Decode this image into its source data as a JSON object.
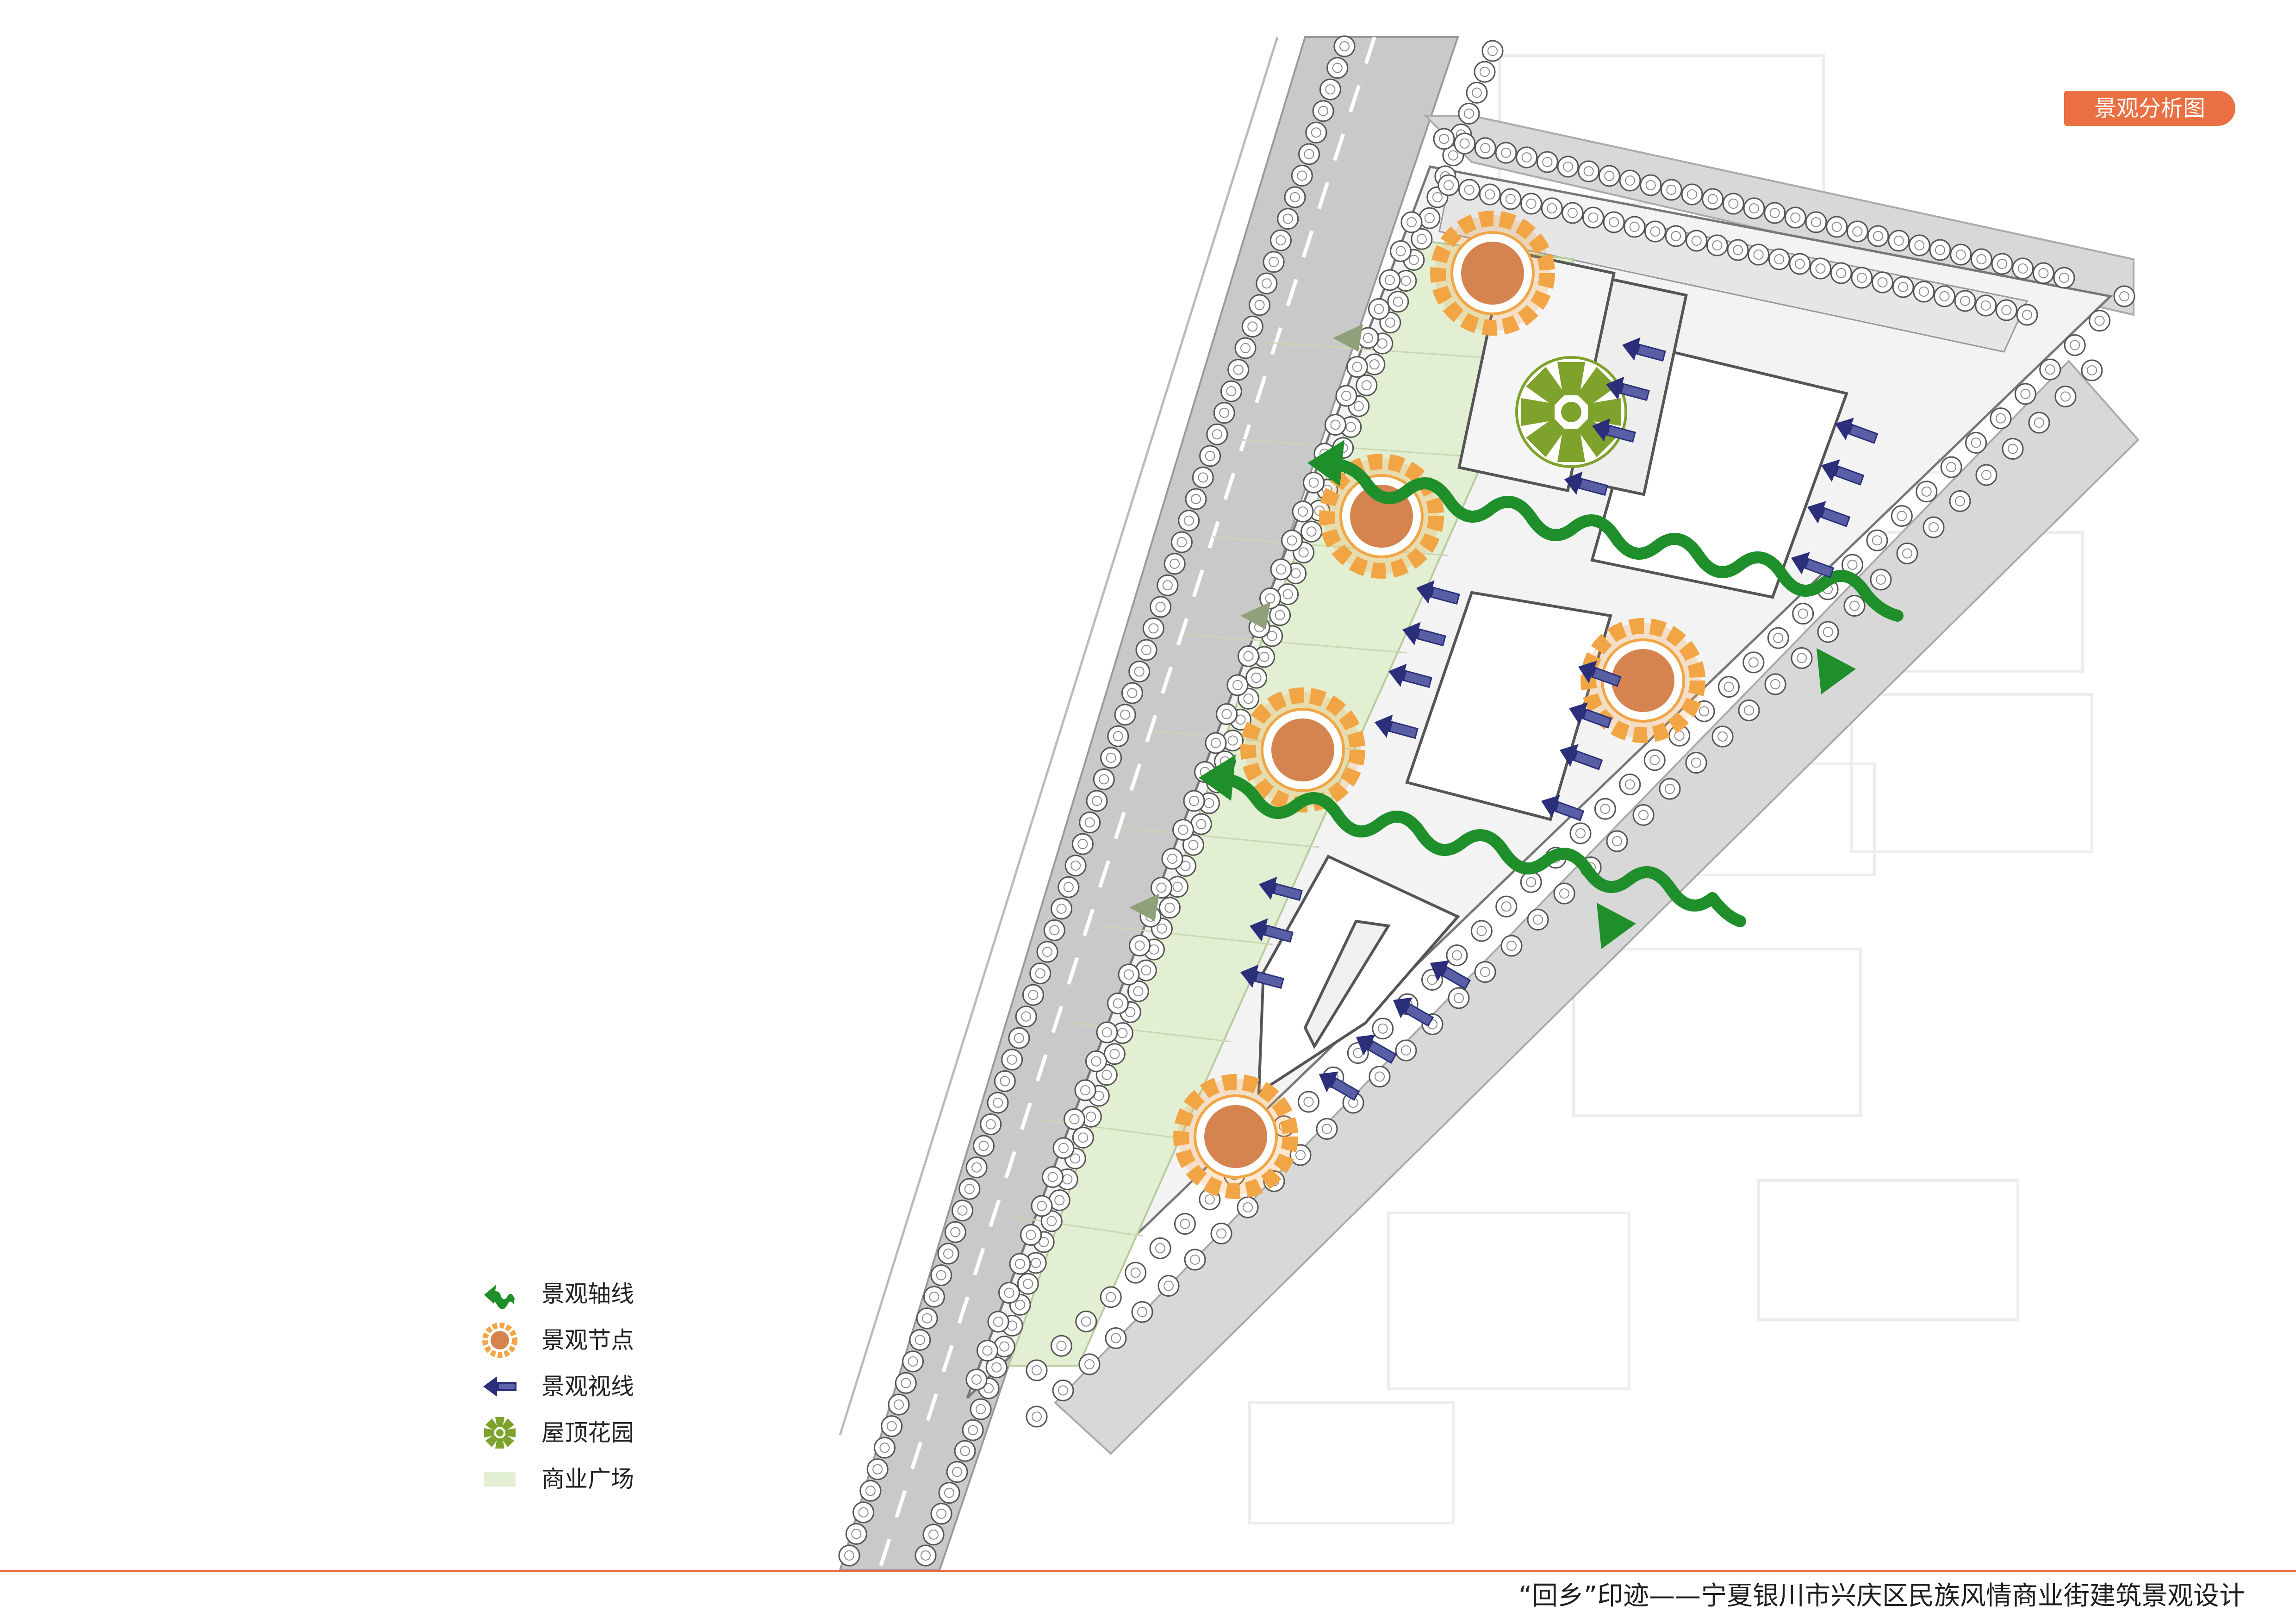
{
  "title": "景观分析图",
  "legend": [
    {
      "icon": "axis-arrow-icon",
      "label": "景观轴线"
    },
    {
      "icon": "node-ring-icon",
      "label": "景观节点"
    },
    {
      "icon": "view-arrow-icon",
      "label": "景观视线"
    },
    {
      "icon": "roof-garden-icon",
      "label": "屋顶花园"
    },
    {
      "icon": "plaza-swatch-icon",
      "label": "商业广场"
    }
  ],
  "footer": "“回乡”印迹——宁夏银川市兴庆区民族风情商业街建筑景观设计",
  "colors": {
    "accent": "#ea6f43",
    "axis_green": "#1e8f2a",
    "node_orange": "#f2a545",
    "node_core": "#d58450",
    "view_navy": "#2b2f7a",
    "roof_green": "#7fa22c",
    "plaza_green": "#e3efd2",
    "road_gray": "#c9c9c9"
  }
}
